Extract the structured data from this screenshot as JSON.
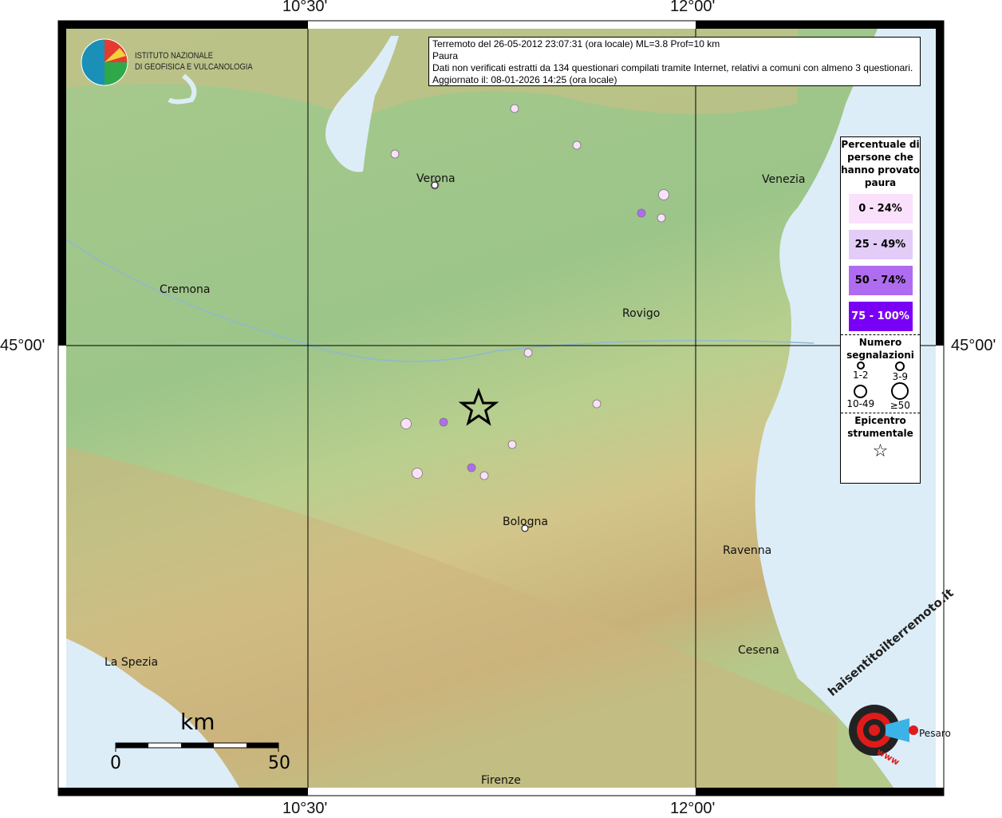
{
  "axes": {
    "top_ticks": [
      "10°30'",
      "12°00'"
    ],
    "bottom_ticks": [
      "10°30'",
      "12°00'"
    ],
    "left_tick": "45°00'",
    "right_tick": "45°00'"
  },
  "info_box": {
    "line1": "Terremoto del 26-05-2012 23:07:31 (ora locale) ML=3.8 Prof=10 km",
    "line2": "Paura",
    "line3": "Dati non verificati estratti da 134 questionari compilati tramite Internet, relativi a comuni con almeno 3 questionari.",
    "line4": "Aggiornato il: 08-01-2026 14:25 (ora locale)"
  },
  "institute_logo": {
    "line1": "ISTITUTO NAZIONALE",
    "line2": "DI GEOFISICA E VULCANOLOGIA"
  },
  "legend": {
    "title": "Percentuale di persone che hanno provato paura",
    "classes": [
      {
        "label": "0 - 24%",
        "color": "#fbe0fb"
      },
      {
        "label": "25 - 49%",
        "color": "#e3ccf7"
      },
      {
        "label": "50 - 74%",
        "color": "#b06cf0"
      },
      {
        "label": "75 - 100%",
        "color": "#7a00f5"
      }
    ],
    "size_title": "Numero segnalazioni",
    "sizes": [
      "1-2",
      "3-9",
      "10-49",
      "≥50"
    ],
    "epicenter_title": "Epicentro strumentale"
  },
  "cities": [
    "Verona",
    "Venezia",
    "Cremona",
    "Rovigo",
    "Bologna",
    "Ravenna",
    "La Spezia",
    "Cesena",
    "Firenze",
    "Pesaro"
  ],
  "scale_bar": {
    "unit": "km",
    "min": "0",
    "max": "50"
  },
  "footer_logo": {
    "text": "haisentitoilterremoto.it",
    "www": "www"
  },
  "points": [
    {
      "cls": 0,
      "size": 1
    },
    {
      "cls": 0,
      "size": 1
    },
    {
      "cls": 0,
      "size": 1
    },
    {
      "cls": 0,
      "size": 2
    },
    {
      "cls": 2,
      "size": 1
    },
    {
      "cls": 0,
      "size": 1
    },
    {
      "cls": 0,
      "size": 1
    },
    {
      "cls": 0,
      "size": 1
    },
    {
      "cls": 0,
      "size": 2
    },
    {
      "cls": 2,
      "size": 1
    },
    {
      "cls": 0,
      "size": 1
    },
    {
      "cls": 0,
      "size": 2
    },
    {
      "cls": 2,
      "size": 1
    },
    {
      "cls": 0,
      "size": 1
    },
    {
      "cls": 0,
      "size": 1
    }
  ]
}
